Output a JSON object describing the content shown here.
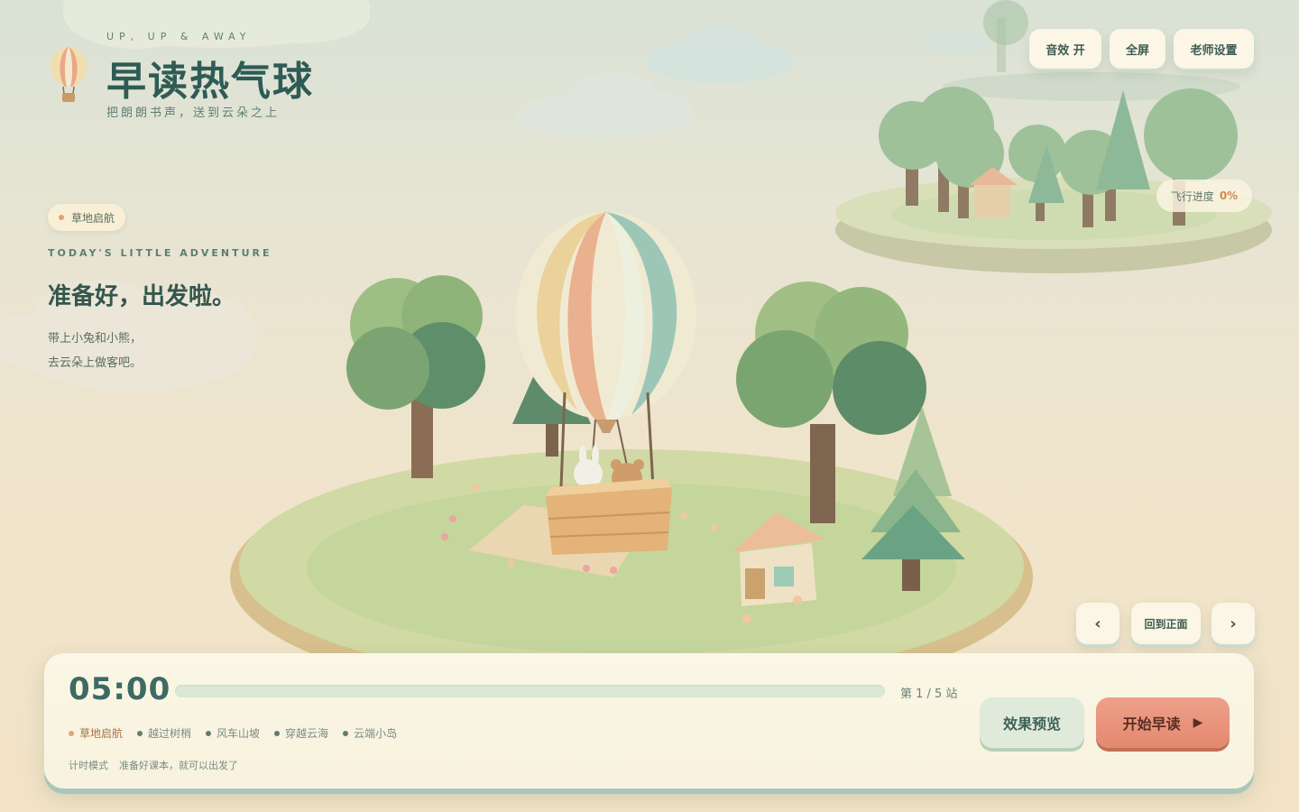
{
  "brand": {
    "kicker": "UP, UP & AWAY",
    "title": "早读热气球",
    "subtitle": "把朗朗书声，送到云朵之上"
  },
  "top_buttons": {
    "sound": "音效 开",
    "fullscreen": "全屏",
    "teacher": "老师设置"
  },
  "flight_progress": {
    "label": "飞行进度",
    "value": "0%"
  },
  "intro": {
    "stage_tag": "草地启航",
    "kicker": "TODAY'S LITTLE ADVENTURE",
    "title": "准备好，出发啦。",
    "line1": "带上小兔和小熊，",
    "line2": "去云朵上做客吧。"
  },
  "nav": {
    "prev": "‹",
    "reset": "回到正面",
    "next": "›"
  },
  "panel": {
    "timer": "05:00",
    "station_count": "第 1 / 5 站",
    "progress_fraction": 0,
    "stations": [
      {
        "label": "草地启航",
        "active": true
      },
      {
        "label": "越过树梢",
        "active": false
      },
      {
        "label": "风车山坡",
        "active": false
      },
      {
        "label": "穿越云海",
        "active": false
      },
      {
        "label": "云端小岛",
        "active": false
      }
    ],
    "mode_label": "计时模式",
    "mode_hint": "准备好课本，就可以出发了",
    "preview_label": "效果预览",
    "start_label": "开始早读",
    "start_icon": "▶"
  },
  "colors": {
    "accent_orange": "#d08a4c",
    "start_button": "#e4896f",
    "station_active": "#a4734a",
    "title_green": "#2f5b55"
  }
}
